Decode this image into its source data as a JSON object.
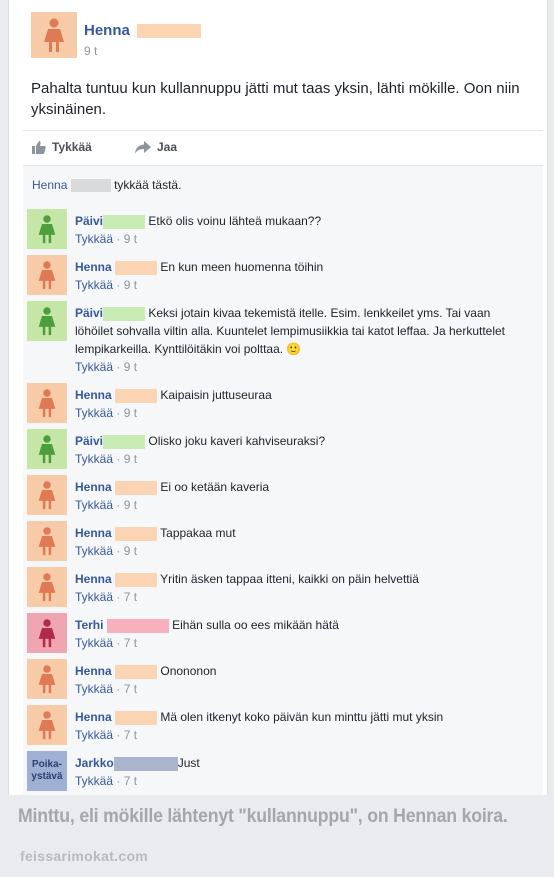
{
  "post": {
    "author": "Henna",
    "time": "9 t",
    "text": "Pahalta tuntuu kun kullannuppu jätti mut taas yksin, lähti mökille. Oon niin yksinäinen.",
    "like_label": "Tykkää",
    "share_label": "Jaa"
  },
  "likes": {
    "name": "Henna",
    "text": "tykkää tästä."
  },
  "comments": [
    {
      "name": "Päivi",
      "text": "Etkö olis voinu lähteä mukaan??",
      "like": "Tykkää",
      "time": "9 t"
    },
    {
      "name": "Henna",
      "text": "En kun meen huomenna töihin",
      "like": "Tykkää",
      "time": "9 t"
    },
    {
      "name": "Päivi",
      "text": "Keksi jotain kivaa tekemistä itelle. Esim. lenkkeilet yms. Tai vaan löhöilet sohvalla viltin alla. Kuuntelet lempimusiikkia tai katot leffaa. Ja herkuttelet lempikarkeilla. Kynttilöitäkin voi polttaa. 🙂",
      "like": "Tykkää",
      "time": "9 t"
    },
    {
      "name": "Henna",
      "text": "Kaipaisin juttuseuraa",
      "like": "Tykkää",
      "time": "9 t"
    },
    {
      "name": "Päivi",
      "text": "Olisko joku kaveri kahviseuraksi?",
      "like": "Tykkää",
      "time": "9 t"
    },
    {
      "name": "Henna",
      "text": "Ei oo ketään kaveria",
      "like": "Tykkää",
      "time": "9 t"
    },
    {
      "name": "Henna",
      "text": "Tappakaa mut",
      "like": "Tykkää",
      "time": "9 t"
    },
    {
      "name": "Henna",
      "text": "Yritin äsken tappaa itteni, kaikki on päin helvettiä",
      "like": "Tykkää",
      "time": "7 t"
    },
    {
      "name": "Terhi",
      "text": "Eihän sulla oo ees mikään hätä",
      "like": "Tykkää",
      "time": "7 t"
    },
    {
      "name": "Henna",
      "text": "Onononon",
      "like": "Tykkää",
      "time": "7 t"
    },
    {
      "name": "Henna",
      "text": "Mä olen itkenyt koko päivän kun minttu jätti mut yksin",
      "like": "Tykkää",
      "time": "7 t"
    },
    {
      "name": "Jarkko",
      "text": "Just",
      "like": "Tykkää",
      "time": "7 t",
      "avatar_text": "Poika-ystävä"
    }
  ],
  "caption": "Minttu, eli mökille lähtenyt \"kullannuppu\", on Hennan koira.",
  "watermark": "feissarimokat.com",
  "colors": {
    "henna": "#f7caa8",
    "paivi": "#c6e6a8",
    "terhi": "#f0a6b2",
    "jarkko": "#9fb0d2",
    "link": "#365899"
  }
}
